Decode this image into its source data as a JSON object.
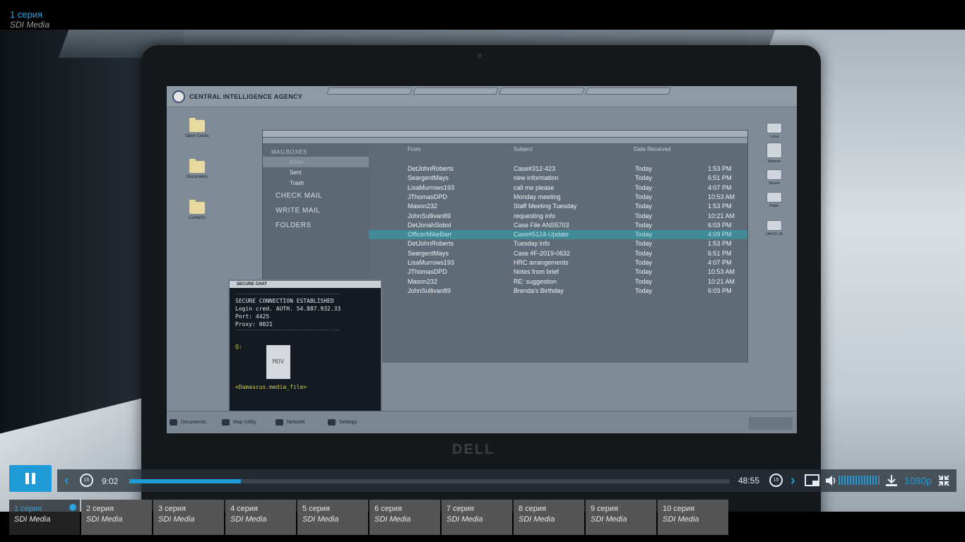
{
  "header": {
    "title": "1 серия",
    "studio": "SDI Media"
  },
  "screen": {
    "agency": "CENTRAL INTELLIGENCE AGENCY",
    "desktop_icons": [
      "Open Cases",
      "Documents",
      "Contacts"
    ],
    "right_icons": [
      "Local",
      "Network",
      "Secure",
      "Public",
      "Unit 02-1A"
    ],
    "mail": {
      "sidebar_header": "MAILBOXES",
      "inbox": "Inbox",
      "sent": "Sent",
      "trash": "Trash",
      "check_mail": "CHECK MAIL",
      "write_mail": "WRITE MAIL",
      "folders": "FOLDERS",
      "col_from": "From",
      "col_subject": "Subject",
      "col_date": "Date Received",
      "rows": [
        {
          "from": "DetJohnRoberts",
          "subject": "Case#312-423",
          "day": "Today",
          "time": "1:53 PM"
        },
        {
          "from": "SeargentMays",
          "subject": "new information",
          "day": "Today",
          "time": "6:51 PM"
        },
        {
          "from": "LisaMurrows193",
          "subject": "call me please",
          "day": "Today",
          "time": "4:07 PM"
        },
        {
          "from": "JThomasDPD",
          "subject": "Monday meeting",
          "day": "Today",
          "time": "10:53 AM"
        },
        {
          "from": "Mason232",
          "subject": "Staff Meeting Tuesday",
          "day": "Today",
          "time": "1:53 PM"
        },
        {
          "from": "JohnSullivan89",
          "subject": "requesting info",
          "day": "Today",
          "time": "10:21 AM"
        },
        {
          "from": "DetJonahSobol",
          "subject": "Case File ANS5703",
          "day": "Today",
          "time": "6:03 PM"
        },
        {
          "from": "OfficerMikeBarr",
          "subject": "Case#5124-Update",
          "day": "Today",
          "time": "4:09 PM"
        },
        {
          "from": "DetJohnRoberts",
          "subject": "Tuesday info",
          "day": "Today",
          "time": "1:53 PM"
        },
        {
          "from": "SeargentMays",
          "subject": "Case #F-2019-0632",
          "day": "Today",
          "time": "6:51 PM"
        },
        {
          "from": "LisaMurrows193",
          "subject": "HRC arrangements",
          "day": "Today",
          "time": "4:07 PM"
        },
        {
          "from": "JThomasDPD",
          "subject": "Notes from brief",
          "day": "Today",
          "time": "10:53 AM"
        },
        {
          "from": "Mason232",
          "subject": "RE: suggestion",
          "day": "Today",
          "time": "10:21 AM"
        },
        {
          "from": "JohnSullivan89",
          "subject": "Brenda's Birthday",
          "day": "Today",
          "time": "6:03 PM"
        }
      ]
    },
    "chat": {
      "title": "SECURE CHAT",
      "line1": "SECURE CONNECTION ESTABLISHED",
      "line2": "Login cred. AUTH. 54.887.932.33",
      "line3": "Port: 4425",
      "line4": "Proxy: 0021",
      "prompt": "Q:",
      "file_label": "MOV",
      "file_name": "<Damascus.media_file>"
    },
    "taskbar": [
      "Documents",
      "Map Utility",
      "Network",
      "Settings"
    ],
    "brand": "DELL"
  },
  "player": {
    "current_time": "9:02",
    "duration": "48:55",
    "progress": 0.186,
    "skip_back": "15",
    "skip_forward": "15",
    "quality": "1080p",
    "volume": 0.93,
    "volume_segments": 15
  },
  "episodes": [
    {
      "title": "1 серия",
      "studio": "SDI Media",
      "active": true
    },
    {
      "title": "2 серия",
      "studio": "SDI Media"
    },
    {
      "title": "3 серия",
      "studio": "SDI Media"
    },
    {
      "title": "4 серия",
      "studio": "SDI Media"
    },
    {
      "title": "5 серия",
      "studio": "SDI Media"
    },
    {
      "title": "6 серия",
      "studio": "SDI Media"
    },
    {
      "title": "7 серия",
      "studio": "SDI Media"
    },
    {
      "title": "8 серия",
      "studio": "SDI Media"
    },
    {
      "title": "9 серия",
      "studio": "SDI Media"
    },
    {
      "title": "10 серия",
      "studio": "SDI Media"
    }
  ],
  "colors": {
    "accent": "#1e9ad6",
    "title_blue": "#2aa1e0"
  }
}
